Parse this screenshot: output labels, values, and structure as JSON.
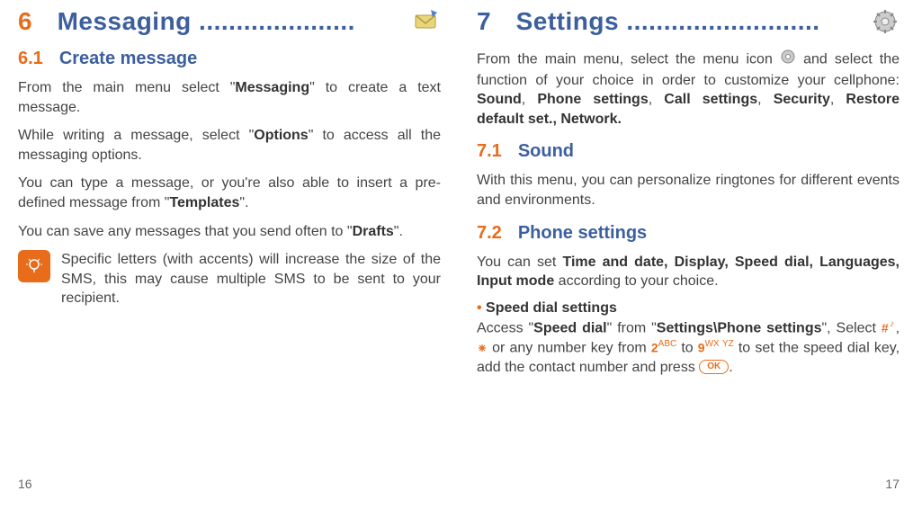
{
  "left": {
    "chapterNum": "6",
    "chapterTitle": "Messaging .....................",
    "sections": {
      "s61": {
        "num": "6.1",
        "title": "Create message"
      }
    },
    "p1a": "From the main menu select \"",
    "p1b": "Messaging",
    "p1c": "\" to create a text message.",
    "p2a": "While writing a message, select \"",
    "p2b": "Options",
    "p2c": "\" to access all the messaging options.",
    "p3a": "You can type a message, or you're also able to insert a pre-defined message from \"",
    "p3b": "Templates",
    "p3c": "\".",
    "p4a": "You can save any messages that you send often to \"",
    "p4b": "Drafts",
    "p4c": "\".",
    "tip": "Specific letters (with accents) will increase the size of the SMS, this may cause multiple SMS to be sent to your recipient.",
    "pageNum": "16"
  },
  "right": {
    "chapterNum": "7",
    "chapterTitle": "Settings ..........................",
    "intro_a": "From the main menu, select the menu icon ",
    "intro_b": " and select the function of your choice in order to customize your cellphone: ",
    "intro_bold": "Sound",
    "intro_c": ", ",
    "intro_bold2": "Phone settings",
    "intro_d": ", ",
    "intro_bold3": "Call settings",
    "intro_e": ", ",
    "intro_bold4": "Security",
    "intro_f": ", ",
    "intro_bold5": "Restore default set., Network.",
    "sections": {
      "s71": {
        "num": "7.1",
        "title": "Sound"
      },
      "s72": {
        "num": "7.2",
        "title": "Phone settings"
      }
    },
    "p71": "With this menu, you can personalize ringtones for different events and environments.",
    "p72a": "You can set ",
    "p72b": "Time and date, Display, Speed dial, Languages, Input mode",
    "p72c": " according to your choice.",
    "bullet": "Speed dial settings",
    "sd_a": "Access \"",
    "sd_b": "Speed dial",
    "sd_c": "\" from \"",
    "sd_d": "Settings\\Phone settings",
    "sd_e": "\", Select ",
    "sd_key1": "#",
    "sd_sup1": "♪",
    "sd_f": ", ",
    "sd_key2": "*",
    "sd_g": " or any number key from ",
    "sd_key3": "2",
    "sd_sup3": "ABC",
    "sd_h": " to ",
    "sd_key4": "9",
    "sd_sup4": "WX YZ",
    "sd_i": " to set the speed dial key, add the contact number and press ",
    "sd_ok": "OK",
    "sd_j": ".",
    "pageNum": "17"
  }
}
